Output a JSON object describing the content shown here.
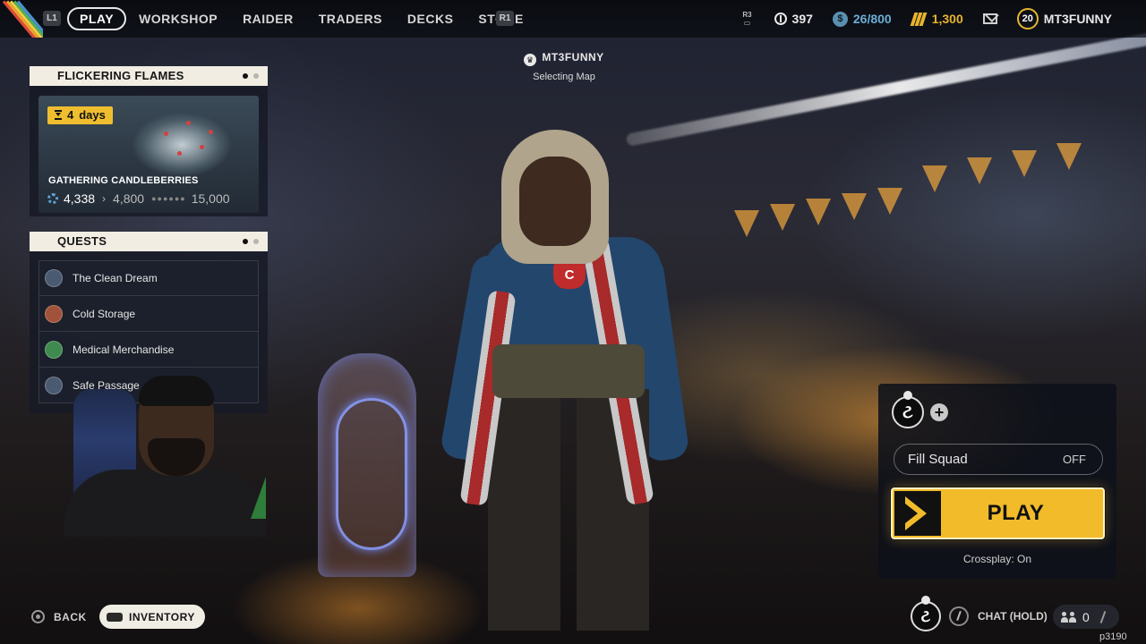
{
  "nav": {
    "l1": "L1",
    "r1": "R1",
    "items": [
      {
        "label": "PLAY",
        "active": true
      },
      {
        "label": "WORKSHOP",
        "active": false
      },
      {
        "label": "RAIDER",
        "active": false
      },
      {
        "label": "TRADERS",
        "active": false
      },
      {
        "label": "DECKS",
        "active": false
      },
      {
        "label": "STORE",
        "active": false
      }
    ]
  },
  "stats": {
    "r3": "R3",
    "coins": "397",
    "cred": "26/800",
    "cred_color": "#6aaed6",
    "gold": "1,300",
    "gold_color": "#e9b32c",
    "level": "20",
    "player": "MT3FUNNY"
  },
  "center": {
    "name": "MT3FUNNY",
    "status": "Selecting Map"
  },
  "event": {
    "title": "FLICKERING FLAMES",
    "timer_value": "4",
    "timer_unit": "days",
    "card_title": "GATHERING CANDLEBERRIES",
    "current": "4,338",
    "next": "4,800",
    "max": "15,000",
    "dots": "●●●●●●"
  },
  "quests": {
    "title": "QUESTS",
    "items": [
      {
        "label": "The Clean Dream",
        "color": "#4a5a70"
      },
      {
        "label": "Cold Storage",
        "color": "#a0523a"
      },
      {
        "label": "Medical Merchandise",
        "color": "#3f8a4e"
      },
      {
        "label": "Safe Passage",
        "color": "#4a5a70"
      }
    ]
  },
  "footer": {
    "back": "BACK",
    "inventory": "INVENTORY",
    "chat": "CHAT (HOLD)",
    "friends_count": "0",
    "watermark": "p3190"
  },
  "squad": {
    "avatar_glyph": "ટ",
    "add": "+",
    "fill_label": "Fill Squad",
    "fill_value": "OFF",
    "play": "PLAY",
    "crossplay": "Crossplay: On",
    "play_color": "#f2bb2a"
  }
}
